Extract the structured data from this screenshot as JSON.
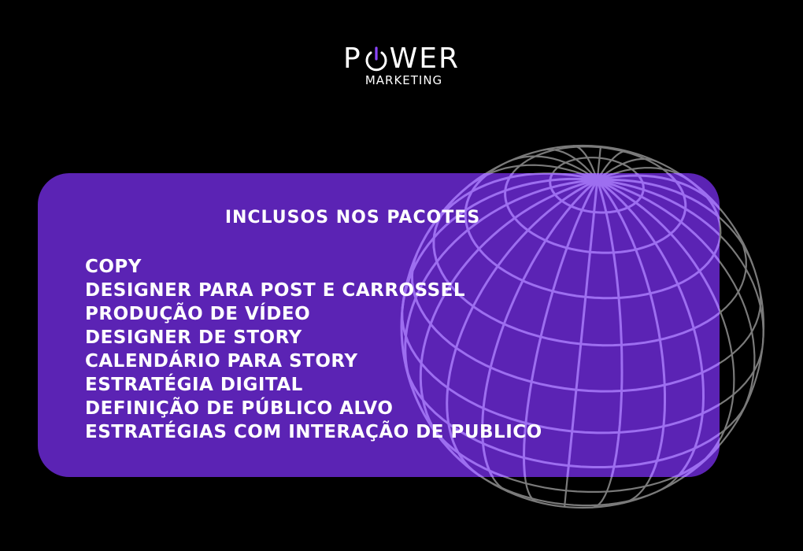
{
  "logo": {
    "p": "P",
    "rest": "WER",
    "subtitle": "MARKETING",
    "icon": "power-icon",
    "accent_color": "#8b45ff"
  },
  "card": {
    "title": "INCLUSOS NOS PACOTES",
    "background": "#5b23b4",
    "items": [
      "COPY",
      "DESIGNER PARA POST E CARROSSEL",
      "PRODUÇÃO DE VÍDEO",
      "DESIGNER DE STORY",
      "CALENDÁRIO PARA STORY",
      "ESTRATÉGIA DIGITAL",
      "DEFINIÇÃO DE PÚBLICO ALVO",
      "ESTRATÉGIAS COM INTERAÇÃO DE PUBLICO"
    ]
  },
  "decoration": {
    "icon": "wireframe-globe",
    "line_color_outside": "#7a7a7a",
    "line_color_inside": "#9d6ef0"
  }
}
